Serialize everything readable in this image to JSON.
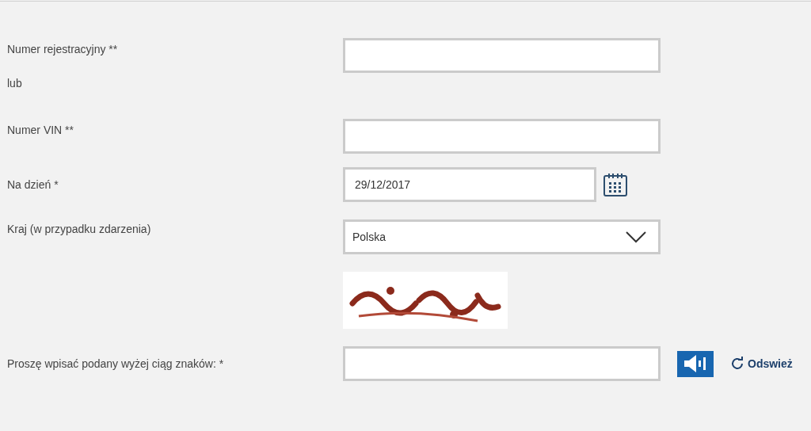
{
  "form": {
    "rows": [
      {
        "kind": "text",
        "label": "Numer rejestracyjny **",
        "value": ""
      },
      {
        "kind": "note",
        "label": "lub"
      },
      {
        "kind": "text",
        "label": "Numer VIN **",
        "value": ""
      },
      {
        "kind": "date",
        "label": "Na dzień *",
        "value": "29/12/2017"
      },
      {
        "kind": "select",
        "label": "Kraj (w przypadku zdarzenia)",
        "value": "Polska"
      },
      {
        "kind": "captcha_image"
      },
      {
        "kind": "captcha",
        "label": "Proszę wpisać podany wyżej ciąg znaków: *",
        "value": "",
        "refresh": "Odswież"
      }
    ]
  }
}
